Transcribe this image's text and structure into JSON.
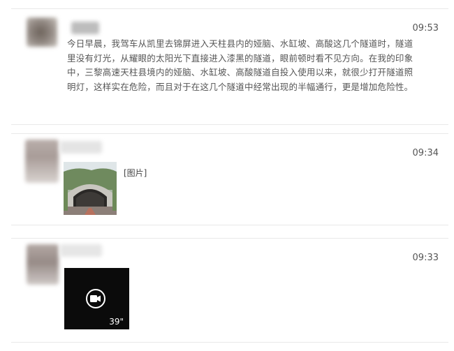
{
  "posts": [
    {
      "time": "09:53",
      "text": "今日早晨，我驾车从凯里去锦屏进入天柱县内的娅脑、水缸坡、高酸这几个隧道时，隧道里没有灯光，从耀眼的太阳光下直接进入漆黑的隧道，眼前顿时看不见方向。在我的印象中，三黎高速天柱县境内的娅脑、水缸坡、高酸隧道自投入使用以来，就很少打开隧道照明灯，这样实在危险，而且对于在这几个隧道中经常出现的半幅通行，更是增加危险性。"
    },
    {
      "time": "09:34",
      "image_label": "[图片]"
    },
    {
      "time": "09:33",
      "video_duration": "39\""
    }
  ],
  "colors": {
    "card_border": "#e9e9e9",
    "text": "#555555",
    "video_bg": "#0b0b0b"
  },
  "icons": [
    "video-camera-icon"
  ]
}
